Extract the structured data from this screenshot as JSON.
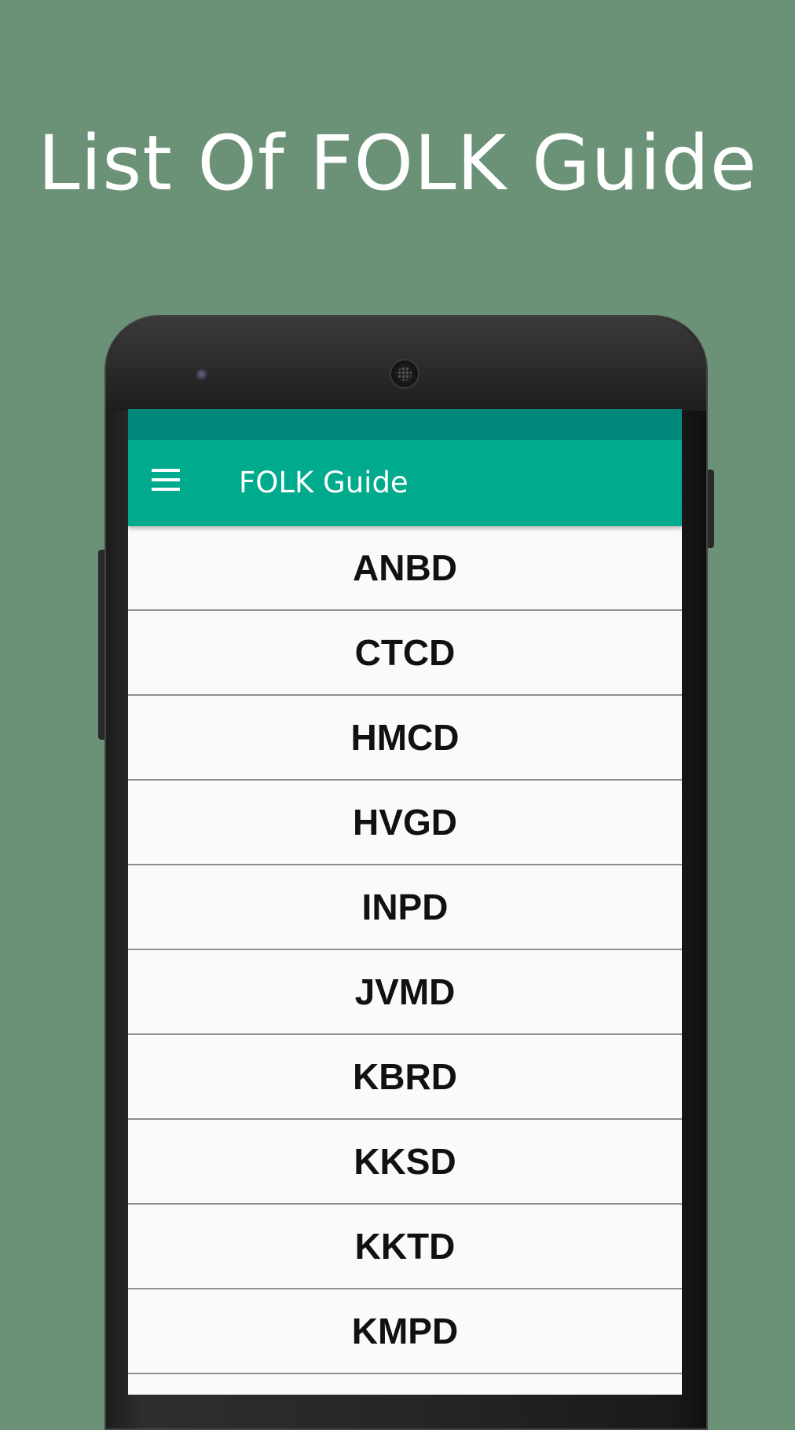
{
  "headline": "List Of FOLK Guide",
  "app": {
    "title": "FOLK Guide",
    "menu_icon": "hamburger-menu-icon"
  },
  "colors": {
    "background": "#6b9176",
    "status_bar": "#00897b",
    "app_bar": "#00aa8d",
    "list_bg": "#fafafa"
  },
  "list": {
    "items": [
      "ANBD",
      "CTCD",
      "HMCD",
      "HVGD",
      "INPD",
      "JVMD",
      "KBRD",
      "KKSD",
      "KKTD",
      "KMPD",
      ""
    ]
  }
}
